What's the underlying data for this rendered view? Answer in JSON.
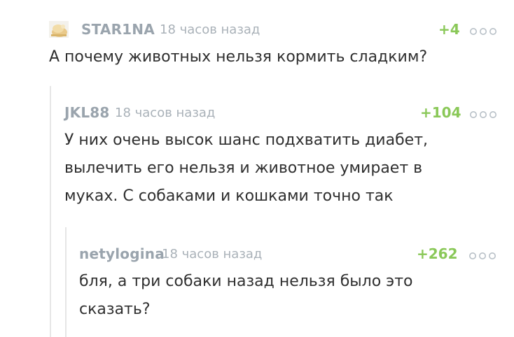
{
  "comments": [
    {
      "username": "STAR1NA",
      "time": "18 часов назад",
      "rating": "+4",
      "text": "А почему животных нельзя кормить сладким?",
      "avatar_icon": "pig-avatar-icon",
      "more_icon": "more-dots-icon"
    },
    {
      "username": "JKL88",
      "time": "18 часов назад",
      "rating": "+104",
      "text": "У них очень высок шанс подхватить диабет,\nвылечить его нельзя и животное умирает в\nмуках. С собаками и кошками точно так",
      "more_icon": "more-dots-icon"
    },
    {
      "username": "netylogina",
      "time": "18 часов назад",
      "rating": "+262",
      "text": "бля, а три собаки назад нельзя было это\nсказать?",
      "more_icon": "more-dots-icon"
    }
  ],
  "colors": {
    "username": "#9aa4ad",
    "timestamp": "#a9b1b8",
    "rating": "#8ac858",
    "text": "#2f2f2f",
    "thread_line": "#e6e6e6"
  }
}
